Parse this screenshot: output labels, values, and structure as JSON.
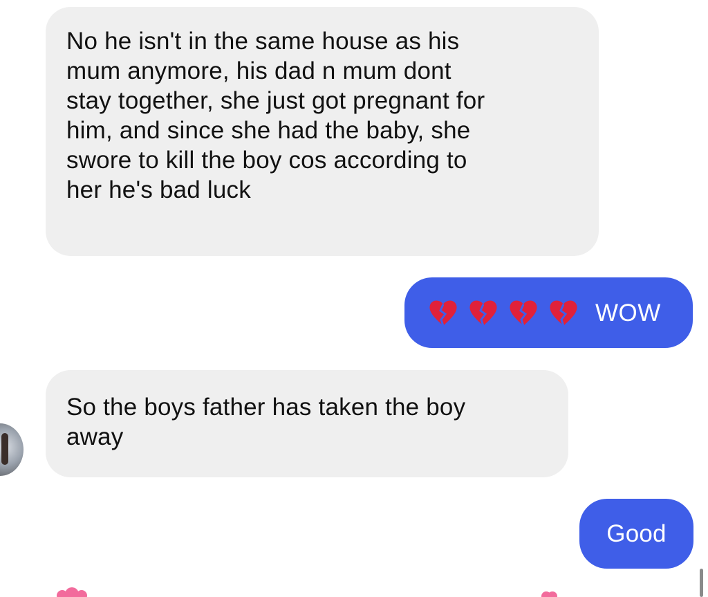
{
  "messages": [
    {
      "direction": "incoming",
      "lines": [
        "No he isn't in the same house as his",
        "mum anymore, his dad n mum dont",
        "stay together, she just got pregnant for",
        "him, and since she had the baby, she",
        "swore to kill the boy cos according to",
        "her he's bad luck"
      ]
    },
    {
      "direction": "outgoing",
      "emoji": "broken-heart",
      "emoji_count": 4,
      "text": "WOW"
    },
    {
      "direction": "incoming",
      "lines": [
        "So the boys father has taken the boy",
        "away"
      ]
    },
    {
      "direction": "outgoing",
      "text": "Good"
    }
  ],
  "colors": {
    "incoming_bubble": "#efefef",
    "outgoing_bubble": "#3f5ee8",
    "broken_heart": "#e0213a",
    "reaction_heart": "#f26b9c"
  },
  "icons": {
    "emoji": "broken-heart-icon",
    "reaction": "heart-reaction-icon",
    "avatar": "sender-avatar"
  }
}
